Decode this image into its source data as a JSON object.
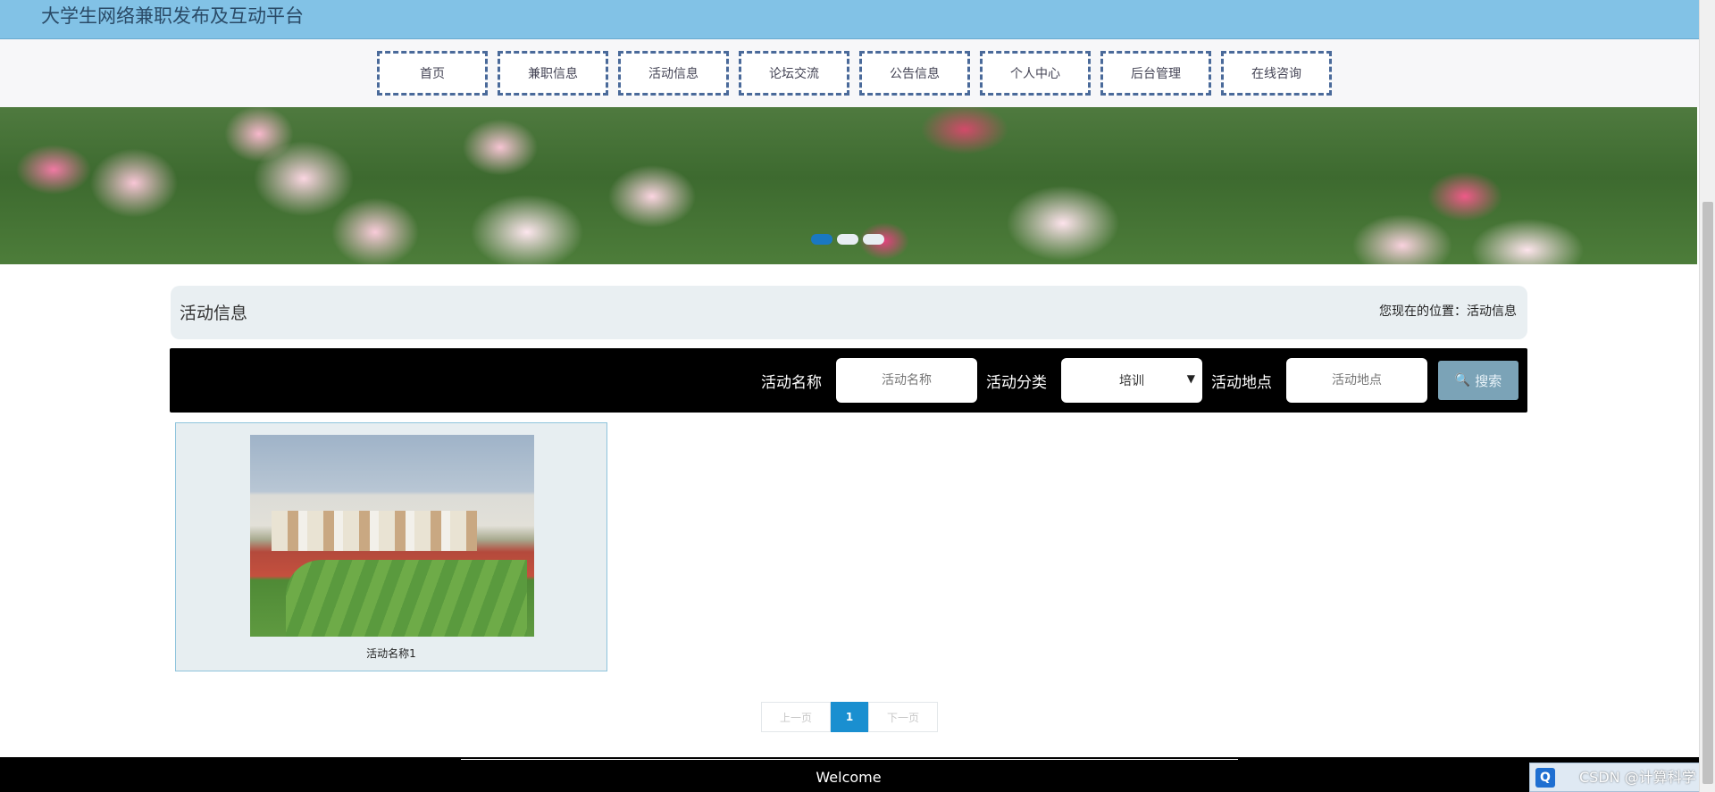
{
  "header": {
    "title": "大学生网络兼职发布及互动平台"
  },
  "nav": [
    {
      "label": "首页"
    },
    {
      "label": "兼职信息"
    },
    {
      "label": "活动信息"
    },
    {
      "label": "论坛交流"
    },
    {
      "label": "公告信息"
    },
    {
      "label": "个人中心"
    },
    {
      "label": "后台管理"
    },
    {
      "label": "在线咨询"
    }
  ],
  "banner": {
    "slide_count": 3,
    "active_slide": 1
  },
  "section": {
    "title": "活动信息",
    "breadcrumb": "您现在的位置：活动信息"
  },
  "search": {
    "name_label": "活动名称",
    "name_placeholder": "活动名称",
    "category_label": "活动分类",
    "category_value": "培训",
    "location_label": "活动地点",
    "location_placeholder": "活动地点",
    "button_label": "搜索",
    "button_icon": "search-icon"
  },
  "activities": [
    {
      "name": "活动名称1"
    }
  ],
  "pagination": {
    "prev": "上一页",
    "current": "1",
    "next": "下一页"
  },
  "footer": {
    "text": "Welcome"
  },
  "watermark": "CSDN @计算科学",
  "colors": {
    "topbar": "#82c2e6",
    "accent": "#1a8fd0",
    "search_bar": "#000000",
    "search_button": "#7ba3b7"
  }
}
